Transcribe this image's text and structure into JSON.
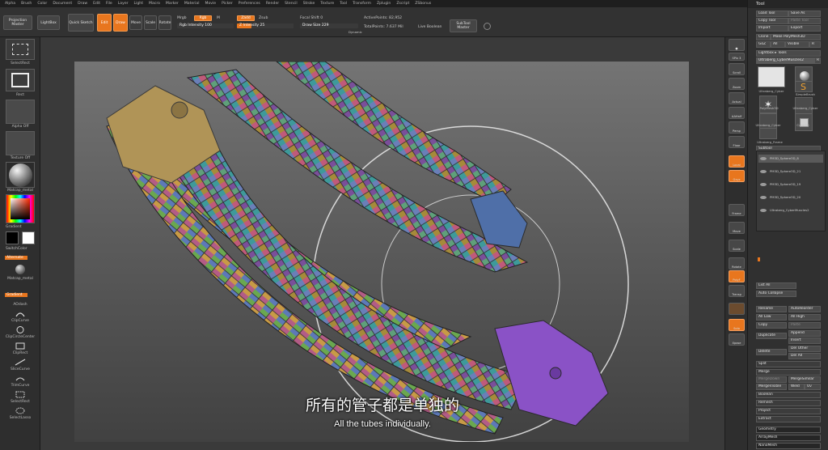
{
  "menu": [
    "Alpha",
    "Brush",
    "Color",
    "Document",
    "Draw",
    "Edit",
    "File",
    "Layer",
    "Light",
    "Macro",
    "Marker",
    "Material",
    "Movie",
    "Picker",
    "Preferences",
    "Render",
    "Stencil",
    "Stroke",
    "Texture",
    "Tool",
    "Transform",
    "Zplugin",
    "Zscript",
    "ZSbonus"
  ],
  "coords": "1.301,2.379,-0.98",
  "shelf": {
    "projection_master": "Projection Master",
    "lightbox": "LightBox",
    "quick_sketch": "Quick Sketch",
    "edit": "Edit",
    "draw": "Draw",
    "move": "Move",
    "scale": "Scale",
    "rotate": "Rotate",
    "mrgb": "Mrgb",
    "rgb": "Rgb",
    "m": "M",
    "rgb_intensity": "Rgb Intensity 100",
    "zadd": "Zadd",
    "zsub": "Zsub",
    "z_intensity": "Z Intensity 25",
    "focal_shift": "Focal Shift 0",
    "draw_size": "Draw Size 229",
    "dynamic": "Dynamic",
    "active_points": "ActivePoints: 82,952",
    "total_points": "TotalPoints: 7.637 Mil",
    "live_boolean": "Live Boolean",
    "subtool_master": "SubTool Master"
  },
  "left": {
    "select_rect": "SelectRect",
    "rect": "Rect",
    "alpha_off": "Alpha Off",
    "texture_off": "Texture Off",
    "matcap": "Matcap_metal",
    "gradient": "Gradient",
    "switch_color": "SwitchColor",
    "alternate": "Alternate",
    "matcap2": "Matcap_metal",
    "gradient2": "Gradient",
    "aodash": "AOdash",
    "clipcurve": "ClipCurve",
    "clipcirclecenter": "ClipCircleCenter",
    "cliprect": "ClipRect",
    "slicecurve": "SliceCurve",
    "trimcurve": "TrimCurve",
    "selectrect": "SelectRect",
    "selectlasso": "SelectLasso"
  },
  "subtitles": {
    "cn": "所有的管子都是单独的",
    "en": "All the tubes individually."
  },
  "right": {
    "spix": "SPix 3",
    "scroll": "Scroll",
    "zoom": "Zoom",
    "actual": "Actual",
    "aahalf": "AAHalf",
    "persp": "Persp",
    "floor": "Floor",
    "local": "Local",
    "gxyz": "Gxyz",
    "frame": "Frame",
    "move": "Move",
    "scale": "Scale",
    "rotate": "Rotate",
    "linefill": "Line Fill",
    "polyf": "PolyF",
    "transp": "Transp",
    "solo": "Solo",
    "xpose": "Xpose"
  },
  "tool": {
    "title": "Tool",
    "load_tool": "Load Tool",
    "save_as": "Save As",
    "copy_tool": "Copy Tool",
    "paste_tool": "Paste Tool",
    "import": "Import",
    "export": "Export",
    "clone": "Clone",
    "make_polymesh": "Make PolyMesh3D",
    "goz": "GoZ",
    "all": "All",
    "visible": "Visible",
    "r": "R",
    "lightbox_tools": "Lightbox ▸ Tools",
    "current_tool": "Ultraberg_CyberMuscles2",
    "slots": [
      "Ultraberg_Cyber",
      "Sphere3D",
      "PolyMesh3D",
      "SimpleBrush",
      "Ultraberg_Cyber",
      "Cube3D",
      "Ultraberg_Frame"
    ],
    "subtool_header": "Subtool",
    "subtools": [
      "PM3D_Sphere3D_8",
      "PM3D_Sphere3D_21",
      "PM3D_Sphere3D_19",
      "PM3D_Sphere3D_20",
      "Ultraberg_CyberMuscles2"
    ],
    "list_all": "List All",
    "auto_collapse": "Auto Collapse",
    "rename": "Rename",
    "autoreorder": "AutoReorder",
    "all_low": "All Low",
    "all_high": "All High",
    "copy": "Copy",
    "paste": "Paste",
    "duplicate": "Duplicate",
    "append": "Append",
    "insert": "Insert",
    "delete": "Delete",
    "del_other": "Del Other",
    "del_all": "Del All",
    "split": "Split",
    "merge": "Merge",
    "merge_down": "MergeDown",
    "merge_similar": "MergeSimilar",
    "merge_visible": "MergeVisible",
    "weld": "Weld",
    "uv": "Uv",
    "boolean": "Boolean",
    "remesh": "Remesh",
    "project": "Project",
    "extract": "Extract",
    "geometry": "Geometry",
    "arraymesh": "ArrayMesh",
    "nanomesh": "NanoMesh"
  },
  "colors": {
    "accent": "#e8761e",
    "panel": "#303030",
    "canvas": "#3a3a3a"
  }
}
